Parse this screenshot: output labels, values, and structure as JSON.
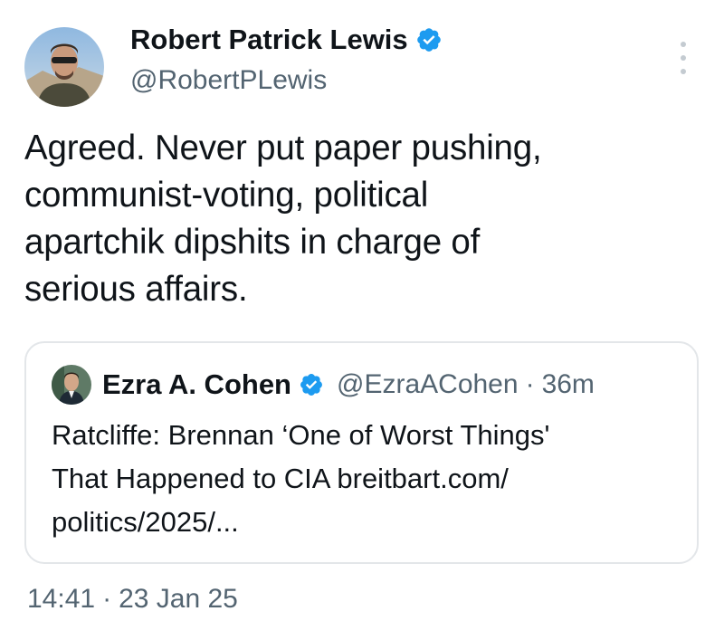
{
  "author": {
    "name": "Robert Patrick Lewis",
    "handle": "@RobertPLewis",
    "verified_color": "#1d9bf0"
  },
  "tweet": {
    "text_lines": [
      "Agreed. Never put paper pushing,",
      "communist-voting, political",
      "apartchik dipshits in charge of",
      "serious affairs."
    ]
  },
  "quote": {
    "name": "Ezra A. Cohen",
    "handle": "@EzraACohen",
    "separator": "·",
    "time": "36m",
    "text_lines": [
      "Ratcliffe: Brennan ‘One of Worst Things'",
      "That Happened to CIA breitbart.com/",
      "politics/2025/..."
    ]
  },
  "timestamp": {
    "time": "14:41",
    "separator": "·",
    "date": "23 Jan 25"
  },
  "icons": {
    "verified": "verified-badge-icon",
    "more": "more-options-icon"
  },
  "colors": {
    "text_primary": "#0f1419",
    "text_secondary": "#536471",
    "border": "#e3e6e9",
    "accent": "#1d9bf0"
  }
}
